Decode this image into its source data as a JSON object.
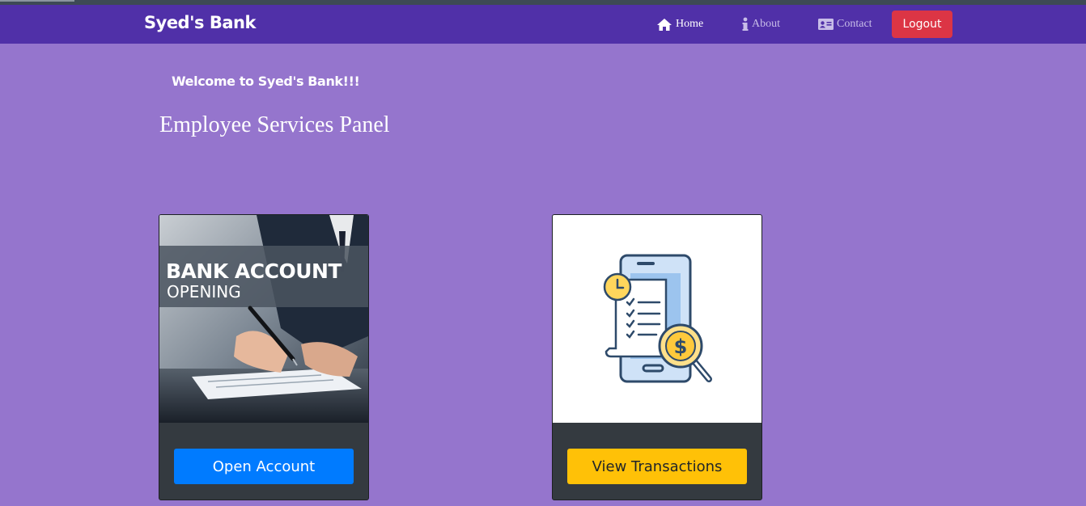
{
  "brand": "Syed's Bank",
  "nav": {
    "home": "Home",
    "about": "About",
    "contact": "Contact",
    "logout": "Logout"
  },
  "welcome": "Welcome to Syed's Bank!!!",
  "panel_title": "Employee Services Panel",
  "cards": [
    {
      "image_title_line1": "BANK ACCOUNT",
      "image_title_line2": "OPENING",
      "button_label": "Open Account",
      "button_color": "#007bff"
    },
    {
      "image_icon": "mobile-transaction-search-icon",
      "button_label": "View Transactions",
      "button_color": "#ffc107"
    }
  ],
  "colors": {
    "page_background": "#9575cd",
    "navbar": "#5030a8",
    "logout": "#dc3545",
    "card_footer": "#343a40"
  }
}
